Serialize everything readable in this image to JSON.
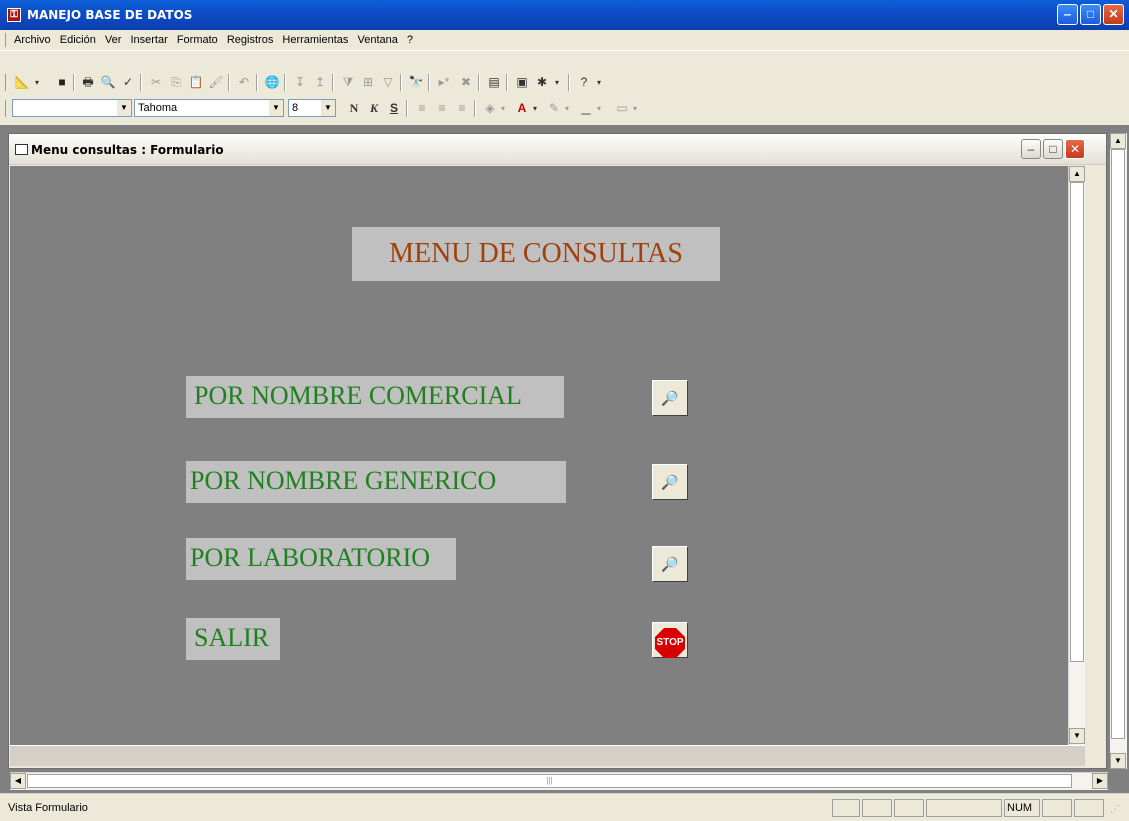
{
  "app": {
    "title": "MANEJO BASE DE DATOS"
  },
  "menubar": {
    "items": [
      {
        "label": "Archivo"
      },
      {
        "label": "Edición"
      },
      {
        "label": "Ver"
      },
      {
        "label": "Insertar"
      },
      {
        "label": "Formato"
      },
      {
        "label": "Registros"
      },
      {
        "label": "Herramientas"
      },
      {
        "label": "Ventana"
      },
      {
        "label": "?"
      }
    ]
  },
  "format_toolbar": {
    "object_combo": "",
    "font": "Tahoma",
    "size": "8",
    "bold": "N",
    "italic": "K",
    "underline": "S"
  },
  "child_window": {
    "title": "Menu consultas : Formulario"
  },
  "form": {
    "heading": "MENU DE CONSULTAS",
    "options": [
      {
        "label": "POR NOMBRE COMERCIAL",
        "button_icon": "query-icon"
      },
      {
        "label": "POR NOMBRE GENERICO",
        "button_icon": "query-icon"
      },
      {
        "label": "POR LABORATORIO",
        "button_icon": "query-icon"
      },
      {
        "label": "SALIR",
        "button_icon": "stop-icon",
        "button_text": "STOP"
      }
    ]
  },
  "status": {
    "text": "Vista Formulario",
    "num": "NUM"
  },
  "colors": {
    "heading": "#A0400C",
    "option_text": "#208020",
    "form_bg": "#808080",
    "label_bg": "#C0C0C0"
  }
}
